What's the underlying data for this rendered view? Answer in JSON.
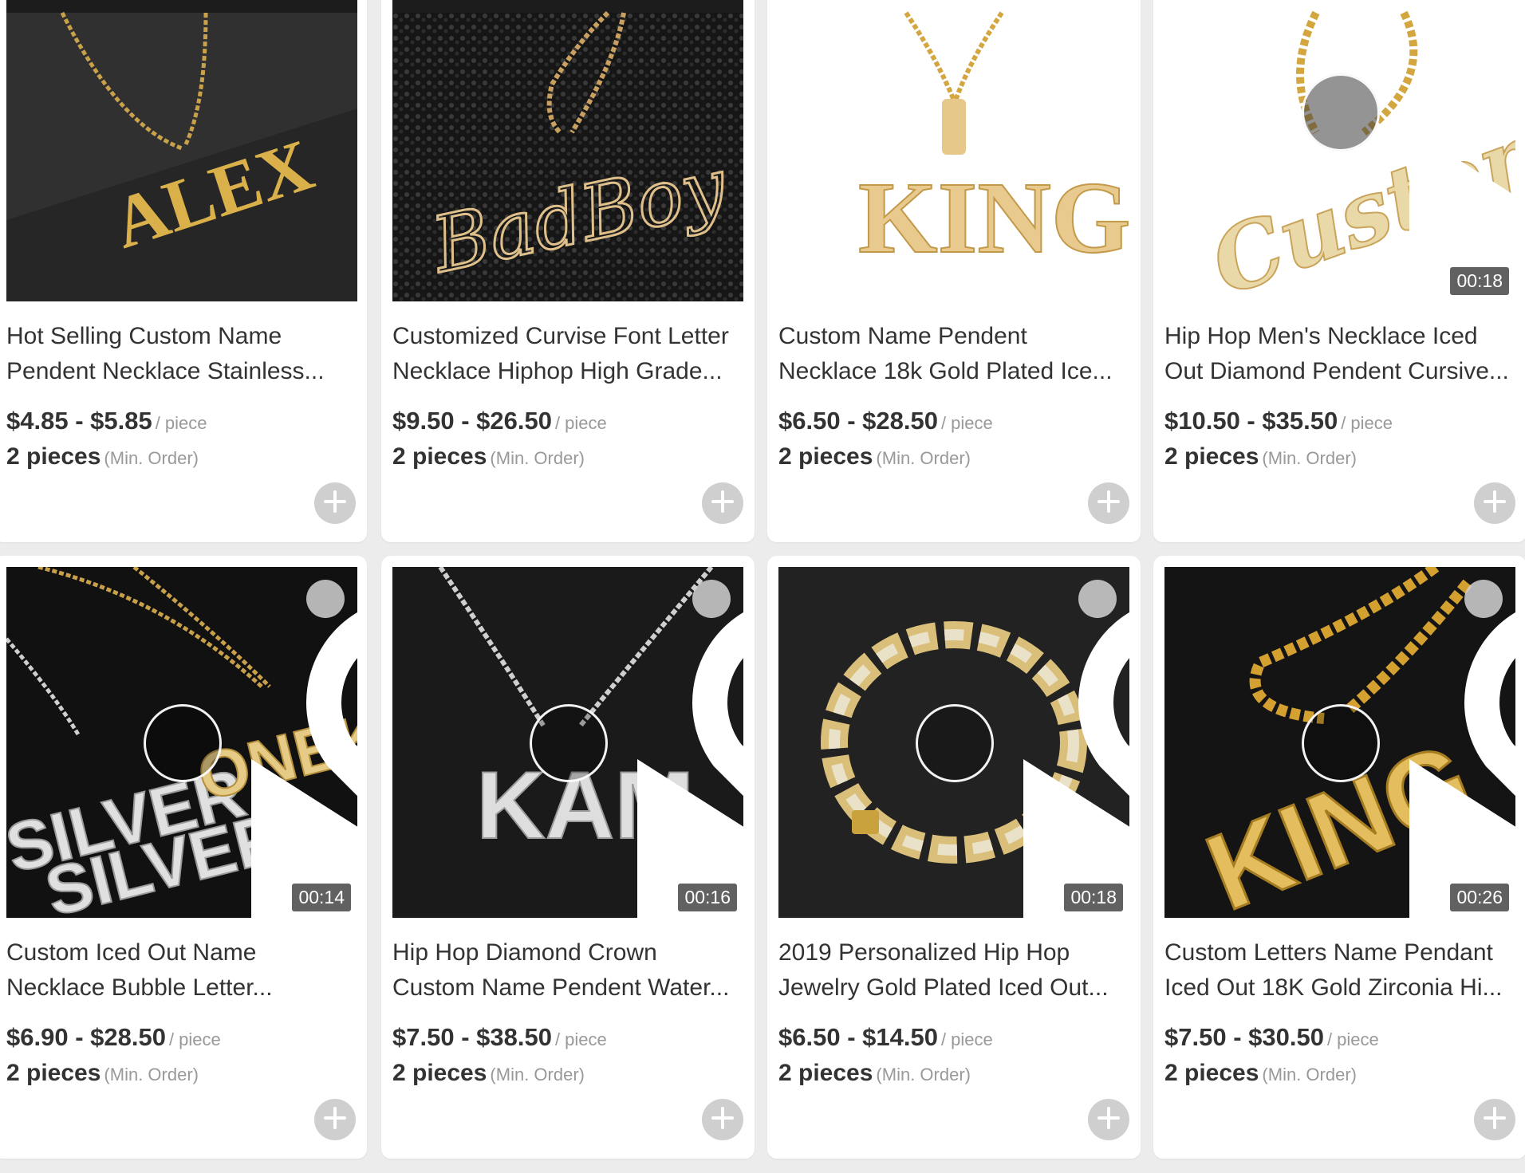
{
  "products": [
    {
      "title_line1": "Hot Selling Custom Name",
      "title_line2": "Pendent Necklace Stainless...",
      "price": "$4.85 - $5.85",
      "unit": "/ piece",
      "moq": "2 pieces",
      "moq_label": "(Min. Order)",
      "pendant_text": "ALEX",
      "has_video": false
    },
    {
      "title_line1": "Customized Curvise Font Letter",
      "title_line2": "Necklace Hiphop High Grade...",
      "price": "$9.50 - $26.50",
      "unit": "/ piece",
      "moq": "2 pieces",
      "moq_label": "(Min. Order)",
      "pendant_text": "BadBoy",
      "has_video": false
    },
    {
      "title_line1": "Custom Name Pendent",
      "title_line2": "Necklace 18k Gold Plated Ice...",
      "price": "$6.50 - $28.50",
      "unit": "/ piece",
      "moq": "2 pieces",
      "moq_label": "(Min. Order)",
      "pendant_text": "KING",
      "has_video": false
    },
    {
      "title_line1": "Hip Hop Men's Necklace Iced",
      "title_line2": "Out Diamond Pendent Cursive...",
      "price": "$10.50 - $35.50",
      "unit": "/ piece",
      "moq": "2 pieces",
      "moq_label": "(Min. Order)",
      "pendant_text": "Custom",
      "has_video": true,
      "duration": "00:18"
    },
    {
      "title_line1": "Custom Iced Out Name",
      "title_line2": "Necklace Bubble Letter...",
      "price": "$6.90 - $28.50",
      "unit": "/ piece",
      "moq": "2 pieces",
      "moq_label": "(Min. Order)",
      "pendant_text": "SILVER ONEK",
      "has_video": true,
      "duration": "00:14"
    },
    {
      "title_line1": "Hip Hop Diamond Crown",
      "title_line2": "Custom Name Pendent Water...",
      "price": "$7.50 - $38.50",
      "unit": "/ piece",
      "moq": "2 pieces",
      "moq_label": "(Min. Order)",
      "pendant_text": "KAM",
      "has_video": true,
      "duration": "00:16"
    },
    {
      "title_line1": "2019 Personalized Hip Hop",
      "title_line2": "Jewelry Gold Plated Iced Out...",
      "price": "$6.50 - $14.50",
      "unit": "/ piece",
      "moq": "2 pieces",
      "moq_label": "(Min. Order)",
      "pendant_text": "",
      "has_video": true,
      "duration": "00:18"
    },
    {
      "title_line1": "Custom Letters Name Pendant",
      "title_line2": "Iced Out 18K Gold Zirconia Hi...",
      "price": "$7.50 - $30.50",
      "unit": "/ piece",
      "moq": "2 pieces",
      "moq_label": "(Min. Order)",
      "pendant_text": "KING",
      "has_video": true,
      "duration": "00:26"
    }
  ],
  "icons": {
    "favorite": "heart-icon",
    "play": "play-icon",
    "add": "plus-icon"
  },
  "colors": {
    "page_bg": "#ececec",
    "card_bg": "#ffffff",
    "text": "#333333",
    "muted": "#999999",
    "gold": "#d9a93a",
    "silver": "#d8d8d8"
  }
}
